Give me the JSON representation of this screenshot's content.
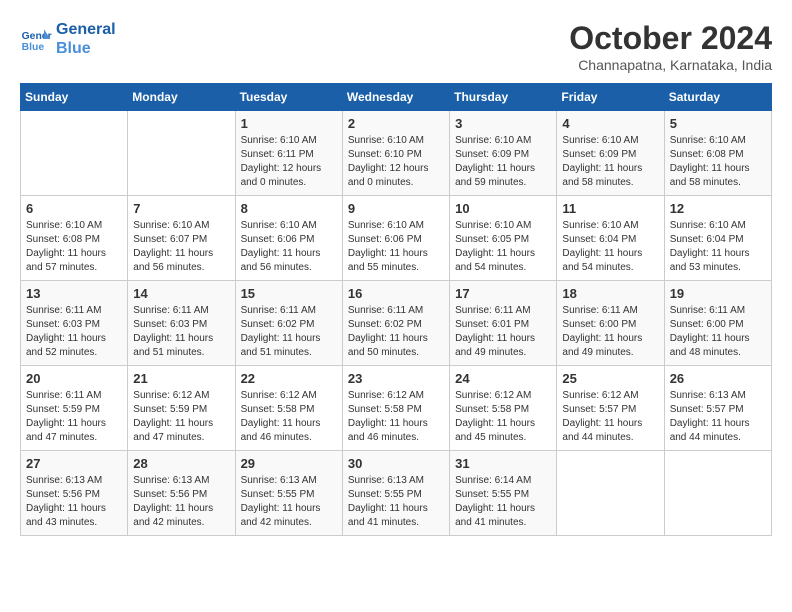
{
  "logo": {
    "line1": "General",
    "line2": "Blue"
  },
  "title": "October 2024",
  "location": "Channapatna, Karnataka, India",
  "days_header": [
    "Sunday",
    "Monday",
    "Tuesday",
    "Wednesday",
    "Thursday",
    "Friday",
    "Saturday"
  ],
  "weeks": [
    [
      {
        "day": "",
        "info": ""
      },
      {
        "day": "",
        "info": ""
      },
      {
        "day": "1",
        "info": "Sunrise: 6:10 AM\nSunset: 6:11 PM\nDaylight: 12 hours\nand 0 minutes."
      },
      {
        "day": "2",
        "info": "Sunrise: 6:10 AM\nSunset: 6:10 PM\nDaylight: 12 hours\nand 0 minutes."
      },
      {
        "day": "3",
        "info": "Sunrise: 6:10 AM\nSunset: 6:09 PM\nDaylight: 11 hours\nand 59 minutes."
      },
      {
        "day": "4",
        "info": "Sunrise: 6:10 AM\nSunset: 6:09 PM\nDaylight: 11 hours\nand 58 minutes."
      },
      {
        "day": "5",
        "info": "Sunrise: 6:10 AM\nSunset: 6:08 PM\nDaylight: 11 hours\nand 58 minutes."
      }
    ],
    [
      {
        "day": "6",
        "info": "Sunrise: 6:10 AM\nSunset: 6:08 PM\nDaylight: 11 hours\nand 57 minutes."
      },
      {
        "day": "7",
        "info": "Sunrise: 6:10 AM\nSunset: 6:07 PM\nDaylight: 11 hours\nand 56 minutes."
      },
      {
        "day": "8",
        "info": "Sunrise: 6:10 AM\nSunset: 6:06 PM\nDaylight: 11 hours\nand 56 minutes."
      },
      {
        "day": "9",
        "info": "Sunrise: 6:10 AM\nSunset: 6:06 PM\nDaylight: 11 hours\nand 55 minutes."
      },
      {
        "day": "10",
        "info": "Sunrise: 6:10 AM\nSunset: 6:05 PM\nDaylight: 11 hours\nand 54 minutes."
      },
      {
        "day": "11",
        "info": "Sunrise: 6:10 AM\nSunset: 6:04 PM\nDaylight: 11 hours\nand 54 minutes."
      },
      {
        "day": "12",
        "info": "Sunrise: 6:10 AM\nSunset: 6:04 PM\nDaylight: 11 hours\nand 53 minutes."
      }
    ],
    [
      {
        "day": "13",
        "info": "Sunrise: 6:11 AM\nSunset: 6:03 PM\nDaylight: 11 hours\nand 52 minutes."
      },
      {
        "day": "14",
        "info": "Sunrise: 6:11 AM\nSunset: 6:03 PM\nDaylight: 11 hours\nand 51 minutes."
      },
      {
        "day": "15",
        "info": "Sunrise: 6:11 AM\nSunset: 6:02 PM\nDaylight: 11 hours\nand 51 minutes."
      },
      {
        "day": "16",
        "info": "Sunrise: 6:11 AM\nSunset: 6:02 PM\nDaylight: 11 hours\nand 50 minutes."
      },
      {
        "day": "17",
        "info": "Sunrise: 6:11 AM\nSunset: 6:01 PM\nDaylight: 11 hours\nand 49 minutes."
      },
      {
        "day": "18",
        "info": "Sunrise: 6:11 AM\nSunset: 6:00 PM\nDaylight: 11 hours\nand 49 minutes."
      },
      {
        "day": "19",
        "info": "Sunrise: 6:11 AM\nSunset: 6:00 PM\nDaylight: 11 hours\nand 48 minutes."
      }
    ],
    [
      {
        "day": "20",
        "info": "Sunrise: 6:11 AM\nSunset: 5:59 PM\nDaylight: 11 hours\nand 47 minutes."
      },
      {
        "day": "21",
        "info": "Sunrise: 6:12 AM\nSunset: 5:59 PM\nDaylight: 11 hours\nand 47 minutes."
      },
      {
        "day": "22",
        "info": "Sunrise: 6:12 AM\nSunset: 5:58 PM\nDaylight: 11 hours\nand 46 minutes."
      },
      {
        "day": "23",
        "info": "Sunrise: 6:12 AM\nSunset: 5:58 PM\nDaylight: 11 hours\nand 46 minutes."
      },
      {
        "day": "24",
        "info": "Sunrise: 6:12 AM\nSunset: 5:58 PM\nDaylight: 11 hours\nand 45 minutes."
      },
      {
        "day": "25",
        "info": "Sunrise: 6:12 AM\nSunset: 5:57 PM\nDaylight: 11 hours\nand 44 minutes."
      },
      {
        "day": "26",
        "info": "Sunrise: 6:13 AM\nSunset: 5:57 PM\nDaylight: 11 hours\nand 44 minutes."
      }
    ],
    [
      {
        "day": "27",
        "info": "Sunrise: 6:13 AM\nSunset: 5:56 PM\nDaylight: 11 hours\nand 43 minutes."
      },
      {
        "day": "28",
        "info": "Sunrise: 6:13 AM\nSunset: 5:56 PM\nDaylight: 11 hours\nand 42 minutes."
      },
      {
        "day": "29",
        "info": "Sunrise: 6:13 AM\nSunset: 5:55 PM\nDaylight: 11 hours\nand 42 minutes."
      },
      {
        "day": "30",
        "info": "Sunrise: 6:13 AM\nSunset: 5:55 PM\nDaylight: 11 hours\nand 41 minutes."
      },
      {
        "day": "31",
        "info": "Sunrise: 6:14 AM\nSunset: 5:55 PM\nDaylight: 11 hours\nand 41 minutes."
      },
      {
        "day": "",
        "info": ""
      },
      {
        "day": "",
        "info": ""
      }
    ]
  ]
}
